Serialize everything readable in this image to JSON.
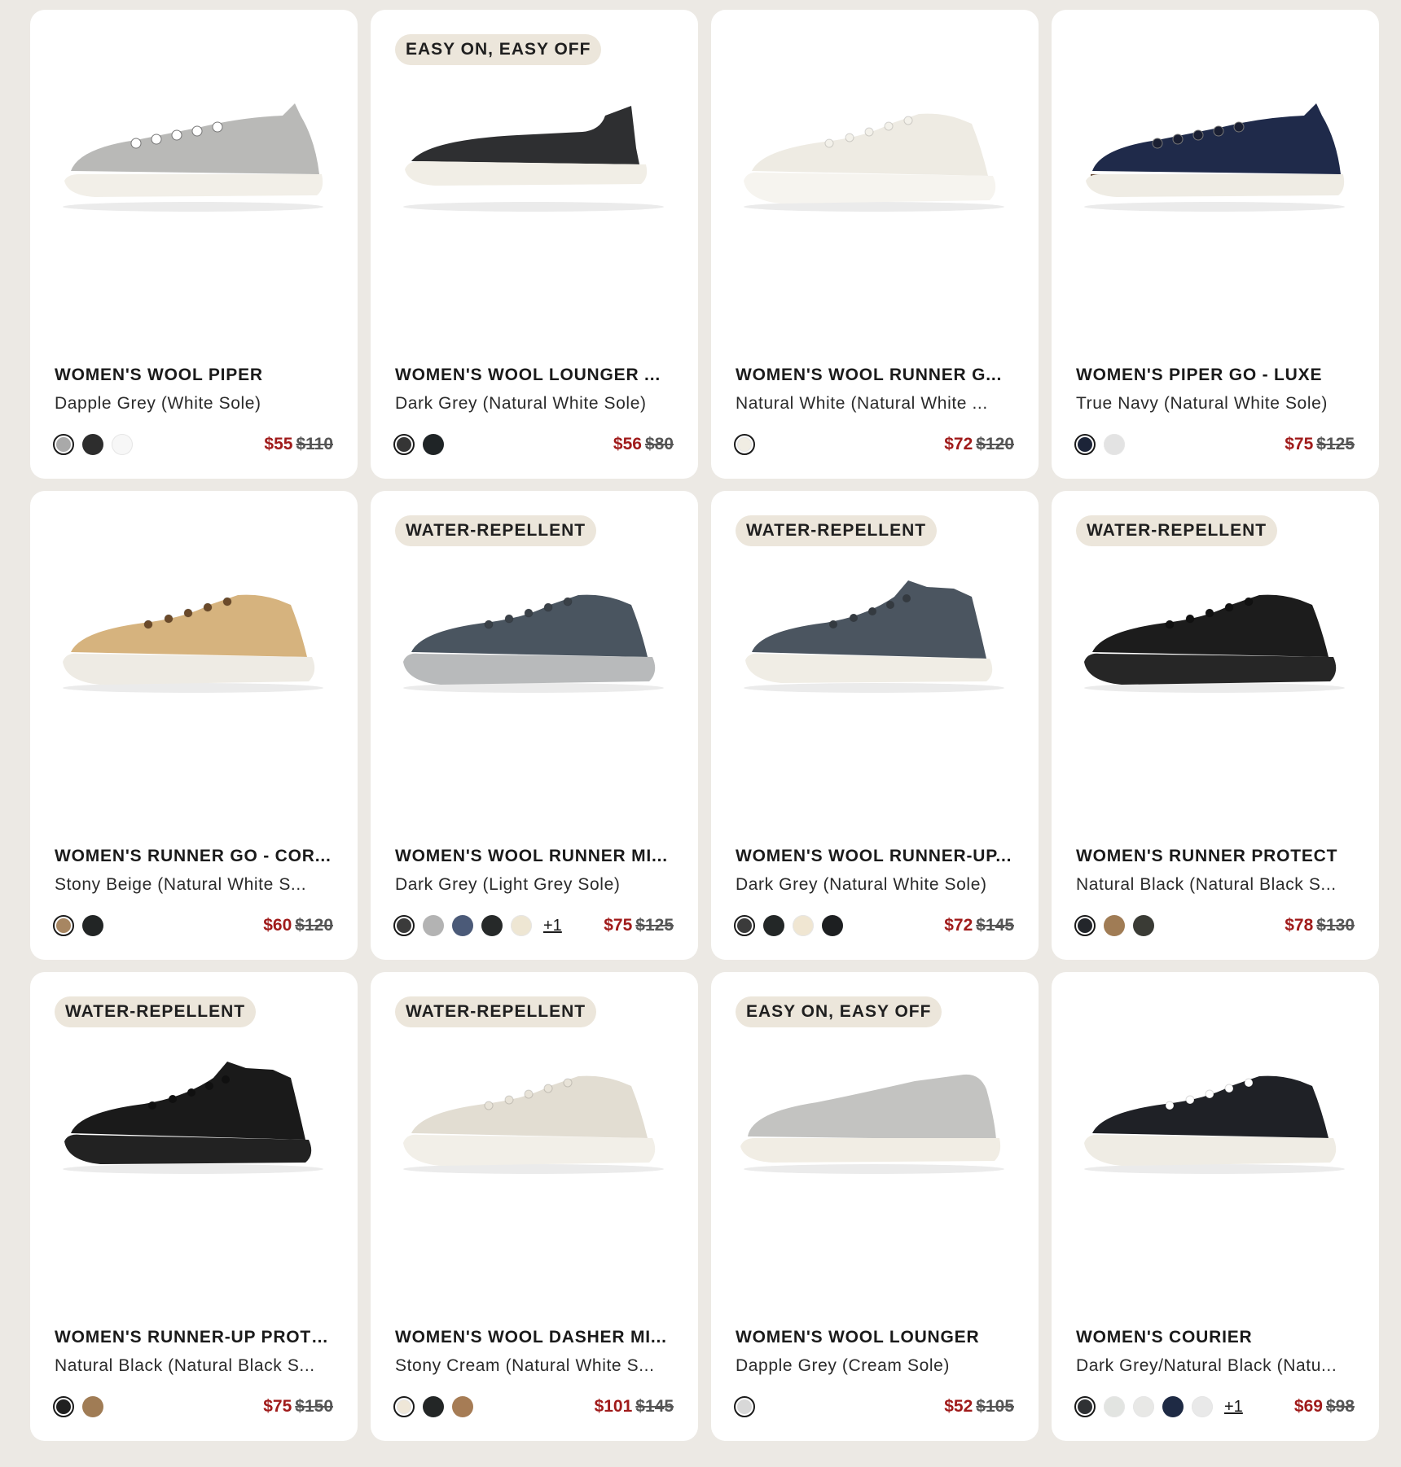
{
  "colors": {
    "sale": "#a01b1b",
    "background": "#ece9e4",
    "badge_bg": "#ece6db"
  },
  "products": [
    {
      "badge": "",
      "title": "WOMEN'S WOOL PIPER",
      "subtitle": "Dapple Grey (White Sole)",
      "shoe": {
        "style": "low",
        "upper": "#b9b9b7",
        "sole": "#f2efe8",
        "lace": "#ffffff",
        "trim": ""
      },
      "swatches": [
        "#a9a9a9",
        "#2d2d2d",
        "#f7f7f7"
      ],
      "more": "",
      "sale_price": "$55",
      "original_price": "$110"
    },
    {
      "badge": "EASY ON, EASY OFF",
      "title": "WOMEN'S WOOL LOUNGER ...",
      "subtitle": "Dark Grey (Natural White Sole)",
      "shoe": {
        "style": "mule",
        "upper": "#2e2f31",
        "sole": "#f1eee6",
        "lace": "",
        "trim": ""
      },
      "swatches": [
        "#353535",
        "#1f2426"
      ],
      "more": "",
      "sale_price": "$56",
      "original_price": "$80"
    },
    {
      "badge": "",
      "title": "WOMEN'S WOOL RUNNER G...",
      "subtitle": "Natural White (Natural White ...",
      "shoe": {
        "style": "runner",
        "upper": "#eeebe3",
        "sole": "#f6f4ef",
        "lace": "#f3f1ea",
        "trim": ""
      },
      "swatches": [
        "#f0ede3"
      ],
      "more": "",
      "sale_price": "$72",
      "original_price": "$120"
    },
    {
      "badge": "",
      "title": "WOMEN'S PIPER GO - LUXE",
      "subtitle": "True Navy (Natural White Sole)",
      "shoe": {
        "style": "low",
        "upper": "#1f2a4a",
        "sole": "#efece4",
        "lace": "#1a1f33",
        "trim": "#6a4e3a"
      },
      "swatches": [
        "#1c2438",
        "#e3e3e3"
      ],
      "more": "",
      "sale_price": "$75",
      "original_price": "$125"
    },
    {
      "badge": "",
      "title": "WOMEN'S RUNNER GO - COR...",
      "subtitle": "Stony Beige (Natural White S...",
      "shoe": {
        "style": "runner",
        "upper": "#d6b37e",
        "sole": "#eeebe4",
        "lace": "#6b4a2a",
        "trim": ""
      },
      "swatches": [
        "#a78662",
        "#222525"
      ],
      "more": "",
      "sale_price": "$60",
      "original_price": "$120"
    },
    {
      "badge": "WATER-REPELLENT",
      "title": "WOMEN'S WOOL RUNNER MI...",
      "subtitle": "Dark Grey (Light Grey Sole)",
      "shoe": {
        "style": "runner",
        "upper": "#4a5560",
        "sole": "#b8babb",
        "lace": "#3a4148",
        "trim": ""
      },
      "swatches": [
        "#3b3b3b",
        "#b3b3b3",
        "#4b5a78",
        "#262929",
        "#eee6d3"
      ],
      "more": "+1",
      "sale_price": "$75",
      "original_price": "$125"
    },
    {
      "badge": "WATER-REPELLENT",
      "title": "WOMEN'S WOOL RUNNER-UP...",
      "subtitle": "Dark Grey (Natural White Sole)",
      "shoe": {
        "style": "mid",
        "upper": "#4b5560",
        "sole": "#f0ede5",
        "lace": "#343a40",
        "trim": ""
      },
      "swatches": [
        "#3b3b3b",
        "#232727",
        "#f0e6d2",
        "#1d1f21"
      ],
      "more": "",
      "sale_price": "$72",
      "original_price": "$145"
    },
    {
      "badge": "WATER-REPELLENT",
      "title": "WOMEN'S RUNNER PROTECT",
      "subtitle": "Natural Black (Natural Black S...",
      "shoe": {
        "style": "runner",
        "upper": "#1c1c1c",
        "sole": "#262626",
        "lace": "#111111",
        "trim": ""
      },
      "swatches": [
        "#23262b",
        "#a07c55",
        "#3a3b35"
      ],
      "more": "",
      "sale_price": "$78",
      "original_price": "$130"
    },
    {
      "badge": "WATER-REPELLENT",
      "title": "WOMEN'S RUNNER-UP PROTE...",
      "subtitle": "Natural Black (Natural Black S...",
      "shoe": {
        "style": "mid",
        "upper": "#1a1a1a",
        "sole": "#222222",
        "lace": "#101010",
        "trim": ""
      },
      "swatches": [
        "#202020",
        "#a07c55"
      ],
      "more": "",
      "sale_price": "$75",
      "original_price": "$150"
    },
    {
      "badge": "WATER-REPELLENT",
      "title": "WOMEN'S WOOL DASHER MI...",
      "subtitle": "Stony Cream (Natural White S...",
      "shoe": {
        "style": "runner",
        "upper": "#e2ddd2",
        "sole": "#f2efe8",
        "lace": "#e8e3d8",
        "trim": ""
      },
      "swatches": [
        "#efe7d8",
        "#232626",
        "#a67c55"
      ],
      "more": "",
      "sale_price": "$101",
      "original_price": "$145"
    },
    {
      "badge": "EASY ON, EASY OFF",
      "title": "WOMEN'S WOOL LOUNGER",
      "subtitle": "Dapple Grey (Cream Sole)",
      "shoe": {
        "style": "loafer",
        "upper": "#c3c3c1",
        "sole": "#f1ede4",
        "lace": "",
        "trim": ""
      },
      "swatches": [
        "#d8d8d8"
      ],
      "more": "",
      "sale_price": "$52",
      "original_price": "$105"
    },
    {
      "badge": "",
      "title": "WOMEN'S COURIER",
      "subtitle": "Dark Grey/Natural Black (Natu...",
      "shoe": {
        "style": "runner",
        "upper": "#1f2126",
        "sole": "#efece4",
        "lace": "#ffffff",
        "trim": ""
      },
      "swatches": [
        "#2f3134",
        "#e2e4e1",
        "#e8e8e6",
        "#1e2a44",
        "#e9e9e9"
      ],
      "more": "+1",
      "sale_price": "$69",
      "original_price": "$98"
    }
  ]
}
